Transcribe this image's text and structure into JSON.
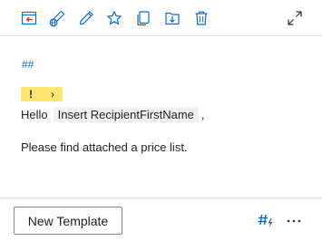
{
  "toolbar": {
    "icons": [
      "insert-template-icon",
      "share-globe-icon",
      "edit-pencil-icon",
      "favorite-star-icon",
      "copy-icon",
      "save-icon",
      "delete-icon",
      "expand-icon"
    ]
  },
  "template": {
    "hashtags": "##",
    "warning_badge": {
      "symbol": "!",
      "chevron": "›",
      "color": "#fde774"
    },
    "greeting": "Hello",
    "placeholder": "Insert RecipientFirstName",
    "comma": ",",
    "body_text": "Please find attached a price list."
  },
  "footer": {
    "new_template_label": "New Template",
    "hashtag_icon": "hashtag-flash-icon",
    "more_icon": "more-options-icon"
  },
  "colors": {
    "accent": "#0f6cbd",
    "warning": "#fde774",
    "text": "#201f1e",
    "border": "#e1dfdd"
  }
}
